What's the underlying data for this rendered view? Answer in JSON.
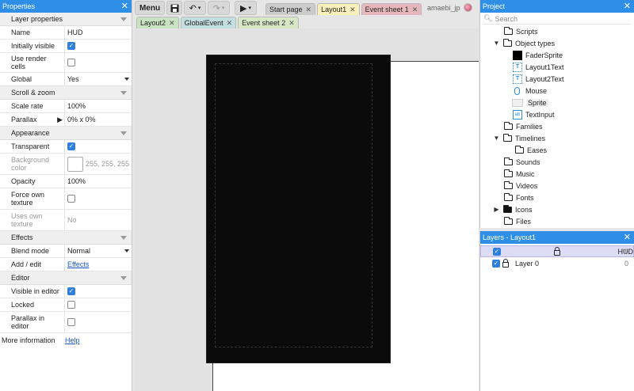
{
  "properties": {
    "title": "Properties",
    "close": "✕",
    "sections": {
      "layer": "Layer properties",
      "scroll": "Scroll & zoom",
      "appearance": "Appearance",
      "effects": "Effects",
      "editor": "Editor"
    },
    "name_label": "Name",
    "name_value": "HUD",
    "visible_label": "Initially visible",
    "render_cells_label": "Use render cells",
    "global_label": "Global",
    "global_value": "Yes",
    "scale_label": "Scale rate",
    "scale_value": "100%",
    "parallax_label": "Parallax",
    "parallax_value": "0% x 0%",
    "transparent_label": "Transparent",
    "bg_color_label": "Background color",
    "bg_color_value": "255, 255, 255",
    "opacity_label": "Opacity",
    "opacity_value": "100%",
    "force_texture_label": "Force own texture",
    "uses_texture_label": "Uses own texture",
    "uses_texture_value": "No",
    "blend_label": "Blend mode",
    "blend_value": "Normal",
    "addedit_label": "Add / edit",
    "addedit_value": "Effects",
    "visible_editor_label": "Visible in editor",
    "locked_label": "Locked",
    "parallax_editor_label": "Parallax in editor",
    "more_label": "More information",
    "more_value": "Help"
  },
  "toolbar": {
    "menu": "Menu",
    "tabs_top": [
      "Start page",
      "Layout1",
      "Event sheet 1"
    ],
    "tabs_second": [
      "Layout2",
      "GlobalEvent",
      "Event sheet 2"
    ],
    "user": "amaebi_jp"
  },
  "project": {
    "title": "Project",
    "close": "✕",
    "search_placeholder": "Search",
    "items": {
      "scripts": "Scripts",
      "object_types": "Object types",
      "fader": "FaderSprite",
      "layout1text": "Layout1Text",
      "layout2text": "Layout2Text",
      "mouse": "Mouse",
      "sprite": "Sprite",
      "textinput": "TextInput",
      "families": "Families",
      "timelines": "Timelines",
      "eases": "Eases",
      "sounds": "Sounds",
      "music": "Music",
      "videos": "Videos",
      "fonts": "Fonts",
      "icons": "Icons",
      "files": "Files"
    }
  },
  "layers": {
    "title": "Layers - Layout1",
    "close": "✕",
    "rows": [
      {
        "name": "HUD",
        "count": "1"
      },
      {
        "name": "Layer 0",
        "count": "0"
      }
    ]
  },
  "colors": {
    "accent": "#2f8fe6",
    "selected_layer": "#dcdcf6"
  }
}
